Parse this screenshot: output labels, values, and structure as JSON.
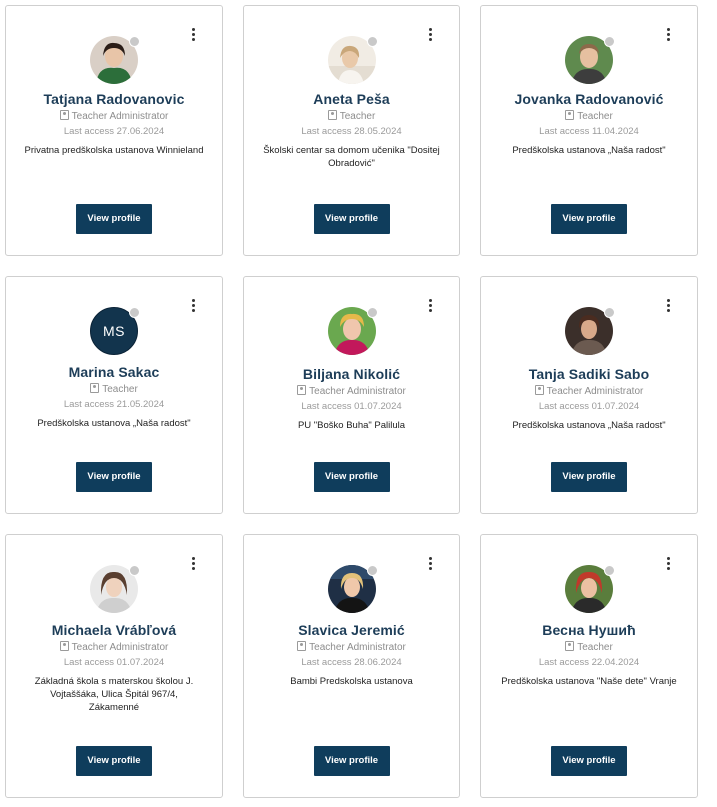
{
  "menu_icon": "kebab-menu-icon",
  "button_color": "#0f3d5c",
  "name_color": "#1d3d58",
  "cards": [
    {
      "name": "Tatjana Radovanovic",
      "role": "Teacher Administrator",
      "last_access": "Last access 27.06.2024",
      "school": "Privatna predškolska ustanova Winnieland",
      "button": "View profile"
    },
    {
      "name": "Aneta Peša",
      "role": "Teacher",
      "last_access": "Last access 28.05.2024",
      "school": "Školski centar sa domom učenika \"Dositej Obradović\"",
      "button": "View profile"
    },
    {
      "name": "Jovanka Radovanović",
      "role": "Teacher",
      "last_access": "Last access 11.04.2024",
      "school": "Predškolska ustanova „Naša radost\"",
      "button": "View profile"
    },
    {
      "name": "Marina Sakac",
      "initials": "MS",
      "role": "Teacher",
      "last_access": "Last access 21.05.2024",
      "school": "Predškolska ustanova „Naša radost\"",
      "button": "View profile"
    },
    {
      "name": "Biljana Nikolić",
      "role": "Teacher Administrator",
      "last_access": "Last access 01.07.2024",
      "school": "PU \"Boško Buha\" Palilula",
      "button": "View profile"
    },
    {
      "name": "Tanja Sadiki Sabo",
      "role": "Teacher Administrator",
      "last_access": "Last access 01.07.2024",
      "school": "Predškolska ustanova „Naša radost\"",
      "button": "View profile"
    },
    {
      "name": "Michaela Vrábľová",
      "role": "Teacher Administrator",
      "last_access": "Last access 01.07.2024",
      "school": "Základná škola s materskou školou J. Vojtaššáka, Ulica Špitál 967/4, Zákamenné",
      "button": "View profile"
    },
    {
      "name": "Slavica Jeremić",
      "role": "Teacher Administrator",
      "last_access": "Last access 28.06.2024",
      "school": "Bambi Predskolska ustanova",
      "button": "View profile"
    },
    {
      "name": "Весна Нушић",
      "role": "Teacher",
      "last_access": "Last access 22.04.2024",
      "school": "Predškolska ustanova \"Naše dete\" Vranje",
      "button": "View profile"
    }
  ]
}
